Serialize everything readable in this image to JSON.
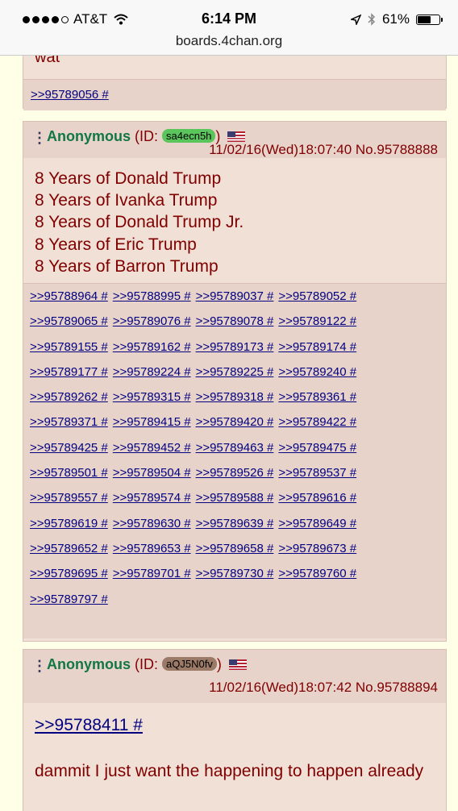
{
  "status": {
    "carrier": "AT&T",
    "time": "6:14 PM",
    "battery": "61%",
    "battery_level": 0.61
  },
  "browser": {
    "url": "boards.4chan.org"
  },
  "posts": [
    {
      "tail_text": "wat",
      "replies": [
        ">>95789056 #"
      ]
    },
    {
      "name": "Anonymous",
      "id_prefix": "(ID: ",
      "id": "sa4ecn5h",
      "id_suffix": ")",
      "id_color": "#5ac55a",
      "datetime": "11/02/16(Wed)18:07:40 No.95788888",
      "lines": [
        "8 Years of Donald Trump",
        "8 Years of Ivanka Trump",
        "8 Years of Donald Trump Jr.",
        "8 Years of Eric Trump",
        "8 Years of Barron Trump"
      ],
      "backlinks": [
        [
          ">>95788964 #",
          ">>95788995 #",
          ">>95789037 #",
          ">>95789052 #"
        ],
        [
          ">>95789065 #",
          ">>95789076 #",
          ">>95789078 #",
          ">>95789122 #"
        ],
        [
          ">>95789155 #",
          ">>95789162 #",
          ">>95789173 #",
          ">>95789174 #"
        ],
        [
          ">>95789177 #",
          ">>95789224 #",
          ">>95789225 #",
          ">>95789240 #"
        ],
        [
          ">>95789262 #",
          ">>95789315 #",
          ">>95789318 #",
          ">>95789361 #"
        ],
        [
          ">>95789371 #",
          ">>95789415 #",
          ">>95789420 #",
          ">>95789422 #"
        ],
        [
          ">>95789425 #",
          ">>95789452 #",
          ">>95789463 #",
          ">>95789475 #"
        ],
        [
          ">>95789501 #",
          ">>95789504 #",
          ">>95789526 #",
          ">>95789537 #"
        ],
        [
          ">>95789557 #",
          ">>95789574 #",
          ">>95789588 #",
          ">>95789616 #"
        ],
        [
          ">>95789619 #",
          ">>95789630 #",
          ">>95789639 #",
          ">>95789649 #"
        ],
        [
          ">>95789652 #",
          ">>95789653 #",
          ">>95789658 #",
          ">>95789673 #"
        ],
        [
          ">>95789695 #",
          ">>95789701 #",
          ">>95789730 #",
          ">>95789760 #"
        ],
        [
          ">>95789797 #"
        ]
      ]
    },
    {
      "name": "Anonymous",
      "id_prefix": "(ID: ",
      "id": "aQJ5N0fv",
      "id_suffix": ")",
      "id_color": "#9b7a67",
      "datetime": "11/02/16(Wed)18:07:42 No.95788894",
      "quote": ">>95788411 #",
      "message": "dammit I just want the happening to happen already"
    }
  ]
}
